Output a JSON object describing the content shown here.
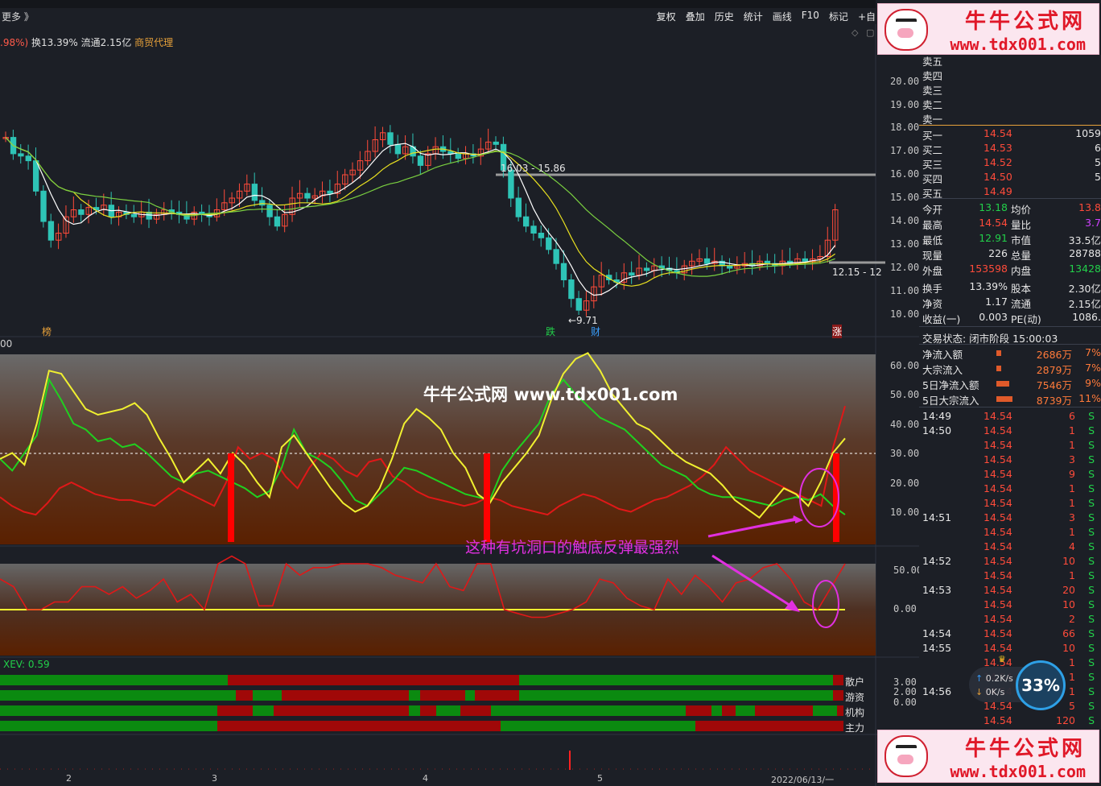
{
  "toolbar": {
    "more_label": "更多 》",
    "menu": [
      "复权",
      "叠加",
      "历史",
      "统计",
      "画线",
      "F10",
      "标记",
      "+自"
    ]
  },
  "info_bar": {
    "change_pct": ".98%)",
    "turnover": "换13.39%",
    "float": "流通2.15亿",
    "sector": "商贸代理"
  },
  "price_axis": [
    "20.00",
    "19.00",
    "18.00",
    "17.00",
    "16.00",
    "15.00",
    "14.00",
    "13.00",
    "12.00",
    "11.00",
    "10.00"
  ],
  "annotations": {
    "level_high": "16.03 - 15.86",
    "level_low": "12.15 - 12",
    "low_mark": "←9.71",
    "marker_bang": "榜",
    "marker_die": "跌",
    "marker_cai": "财",
    "marker_zhang": "涨",
    "zero_label": "00"
  },
  "indicator1": {
    "axis": [
      "60.00",
      "50.00",
      "40.00",
      "30.00",
      "20.00",
      "10.00"
    ],
    "watermark": "牛牛公式网 www.tdx001.com",
    "note": "这种有坑洞口的触底反弹最强烈"
  },
  "indicator2": {
    "axis": [
      "50.00",
      "0.00"
    ]
  },
  "indicator3": {
    "title": "XEV: 0.59",
    "axis": [
      "3.00",
      "2.00",
      "0.00"
    ],
    "rows": [
      "散户",
      "游资",
      "机构",
      "主力"
    ]
  },
  "time_axis": [
    "2",
    "3",
    "4",
    "5",
    "2022/06/13/一"
  ],
  "order_book": {
    "sells": [
      "卖五",
      "卖四",
      "卖三",
      "卖二",
      "卖一"
    ],
    "buys": [
      {
        "label": "买一",
        "price": "14.54",
        "vol": "1059"
      },
      {
        "label": "买二",
        "price": "14.53",
        "vol": "6"
      },
      {
        "label": "买三",
        "price": "14.52",
        "vol": "5"
      },
      {
        "label": "买四",
        "price": "14.50",
        "vol": "5"
      },
      {
        "label": "买五",
        "price": "14.49",
        "vol": ""
      }
    ]
  },
  "quote": [
    {
      "l1": "今开",
      "v1": "13.18",
      "c1": "grn",
      "l2": "均价",
      "v2": "13.8",
      "c2": "red"
    },
    {
      "l1": "最高",
      "v1": "14.54",
      "c1": "red",
      "l2": "量比",
      "v2": "3.7",
      "c2": "mag"
    },
    {
      "l1": "最低",
      "v1": "12.91",
      "c1": "grn",
      "l2": "市值",
      "v2": "33.5亿",
      "c2": "wht"
    },
    {
      "l1": "现量",
      "v1": "226",
      "c1": "wht",
      "l2": "总量",
      "v2": "28788",
      "c2": "wht"
    },
    {
      "l1": "外盘",
      "v1": "153598",
      "c1": "red",
      "l2": "内盘",
      "v2": "13428",
      "c2": "grn"
    },
    {
      "l1": "换手",
      "v1": "13.39%",
      "c1": "wht",
      "l2": "股本",
      "v2": "2.30亿",
      "c2": "wht"
    },
    {
      "l1": "净资",
      "v1": "1.17",
      "c1": "wht",
      "l2": "流通",
      "v2": "2.15亿",
      "c2": "wht"
    },
    {
      "l1": "收益(一)",
      "v1": "0.003",
      "c1": "wht",
      "l2": "PE(动)",
      "v2": "1086.",
      "c2": "wht"
    }
  ],
  "trade_status": "交易状态: 闭市阶段 15:00:03",
  "fund_flow": [
    {
      "label": "净流入额",
      "value": "2686万",
      "pct": "7%"
    },
    {
      "label": "大宗流入",
      "value": "2879万",
      "pct": "7%"
    },
    {
      "label": "5日净流入额",
      "value": "7546万",
      "pct": "9%"
    },
    {
      "label": "5日大宗流入",
      "value": "8739万",
      "pct": "11%"
    }
  ],
  "ticks": [
    {
      "time": "14:49",
      "price": "14.54",
      "vol": "6",
      "side": "S"
    },
    {
      "time": "14:50",
      "price": "14.54",
      "vol": "1",
      "side": "S"
    },
    {
      "time": "",
      "price": "14.54",
      "vol": "1",
      "side": "S"
    },
    {
      "time": "",
      "price": "14.54",
      "vol": "3",
      "side": "S"
    },
    {
      "time": "",
      "price": "14.54",
      "vol": "9",
      "side": "S"
    },
    {
      "time": "",
      "price": "14.54",
      "vol": "1",
      "side": "S"
    },
    {
      "time": "",
      "price": "14.54",
      "vol": "1",
      "side": "S"
    },
    {
      "time": "14:51",
      "price": "14.54",
      "vol": "3",
      "side": "S"
    },
    {
      "time": "",
      "price": "14.54",
      "vol": "1",
      "side": "S"
    },
    {
      "time": "",
      "price": "14.54",
      "vol": "4",
      "side": "S"
    },
    {
      "time": "14:52",
      "price": "14.54",
      "vol": "10",
      "side": "S"
    },
    {
      "time": "",
      "price": "14.54",
      "vol": "1",
      "side": "S"
    },
    {
      "time": "14:53",
      "price": "14.54",
      "vol": "20",
      "side": "S"
    },
    {
      "time": "",
      "price": "14.54",
      "vol": "10",
      "side": "S"
    },
    {
      "time": "",
      "price": "14.54",
      "vol": "2",
      "side": "S"
    },
    {
      "time": "14:54",
      "price": "14.54",
      "vol": "66",
      "side": "S"
    },
    {
      "time": "14:55",
      "price": "14.54",
      "vol": "10",
      "side": "S"
    },
    {
      "time": "",
      "price": "14.54",
      "vol": "1",
      "side": "S"
    },
    {
      "time": "",
      "price": "14.54",
      "vol": "1",
      "side": "S"
    },
    {
      "time": "14:56",
      "price": "14.54",
      "vol": "1",
      "side": "S"
    },
    {
      "time": "",
      "price": "14.54",
      "vol": "5",
      "side": "S"
    },
    {
      "time": "",
      "price": "14.54",
      "vol": "120",
      "side": "S"
    }
  ],
  "banner": {
    "name": "牛牛公式网",
    "url": "www.tdx001.com"
  },
  "net_speed": {
    "up": "0.2K/s",
    "down": "0K/s"
  },
  "cpu_pct": "33%",
  "colors": {
    "up": "#ff4b3a",
    "down": "#22d04a",
    "accent": "#e7a13a"
  }
}
